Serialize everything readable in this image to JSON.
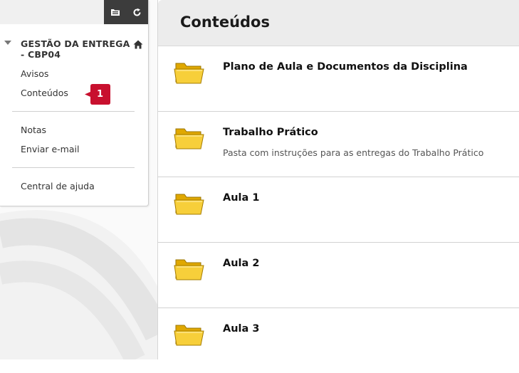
{
  "toolbar": {
    "icons": [
      "folder-view-icon",
      "refresh-icon"
    ]
  },
  "course_menu": {
    "course_title": "GESTÃO DA ENTREGA - CBP04",
    "items": [
      {
        "label": "Avisos"
      },
      {
        "label": "Conteúdos",
        "badge": "1"
      },
      {
        "label": "Notas"
      },
      {
        "label": "Enviar e-mail"
      },
      {
        "label": "Central de ajuda"
      }
    ]
  },
  "main": {
    "title": "Conteúdos",
    "items": [
      {
        "title": "Plano de Aula e Documentos da Disciplina",
        "description": ""
      },
      {
        "title": "Trabalho Prático",
        "description": "Pasta com instruções para as entregas do Trabalho Prático"
      },
      {
        "title": "Aula 1",
        "description": ""
      },
      {
        "title": "Aula 2",
        "description": ""
      },
      {
        "title": "Aula 3",
        "description": ""
      }
    ]
  },
  "colors": {
    "toolbar_dark": "#3c3c3c",
    "badge_red": "#c8102e",
    "folder_yellow": "#f5c518"
  }
}
